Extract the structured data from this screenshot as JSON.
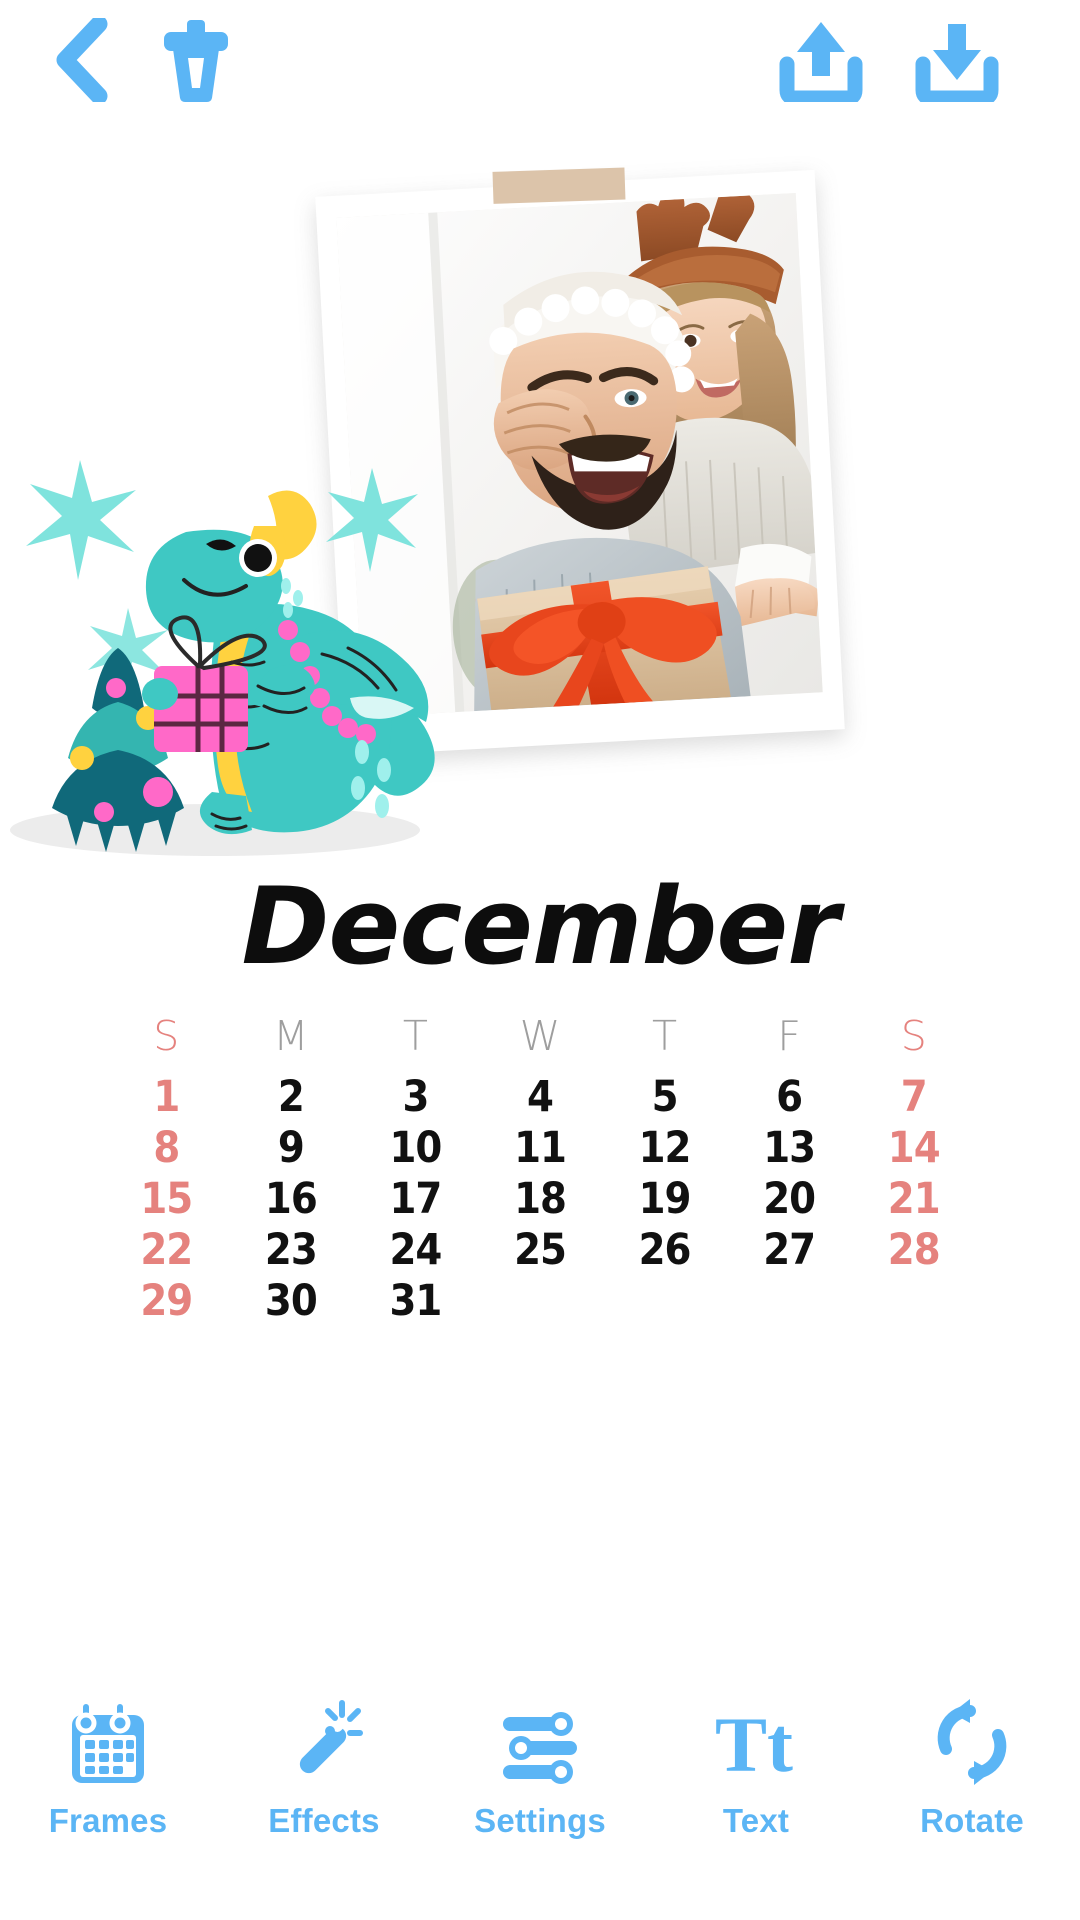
{
  "theme": {
    "accent": "#5bb5f5",
    "weekend": "#e5827e",
    "weekday": "#111111",
    "dayhead": "#9e9e9e",
    "background": "#ffffff",
    "tape": "#d9bfa3"
  },
  "topbar": {
    "back": {
      "label": "Back",
      "icon": "chevron-left-icon"
    },
    "delete": {
      "label": "Delete",
      "icon": "trash-icon"
    },
    "share": {
      "label": "Share",
      "icon": "upload-icon"
    },
    "save": {
      "label": "Save",
      "icon": "download-icon"
    }
  },
  "canvas": {
    "photo": {
      "alt": "Father wearing a Santa hat holding a kraft gift box with a red ribbon while a girl in reindeer antlers hugs him",
      "frame_style": "polaroid",
      "tape": "masking-tape"
    },
    "decor": {
      "items": [
        "dragon-sticker",
        "christmas-tree-sticker",
        "sparkle-stars"
      ]
    },
    "month_title": "December"
  },
  "calendar": {
    "day_headers": [
      "S",
      "M",
      "T",
      "W",
      "T",
      "F",
      "S"
    ],
    "weekend_columns": [
      0,
      6
    ],
    "weeks": [
      [
        "1",
        "2",
        "3",
        "4",
        "5",
        "6",
        "7"
      ],
      [
        "8",
        "9",
        "10",
        "11",
        "12",
        "13",
        "14"
      ],
      [
        "15",
        "16",
        "17",
        "18",
        "19",
        "20",
        "21"
      ],
      [
        "22",
        "23",
        "24",
        "25",
        "26",
        "27",
        "28"
      ],
      [
        "29",
        "30",
        "31",
        "",
        "",
        "",
        ""
      ]
    ]
  },
  "bottombar": {
    "items": [
      {
        "label": "Frames",
        "icon": "calendar-icon"
      },
      {
        "label": "Effects",
        "icon": "magic-wand-icon"
      },
      {
        "label": "Settings",
        "icon": "sliders-icon"
      },
      {
        "label": "Text",
        "icon": "text-tt-icon"
      },
      {
        "label": "Rotate",
        "icon": "rotate-icon"
      }
    ]
  }
}
